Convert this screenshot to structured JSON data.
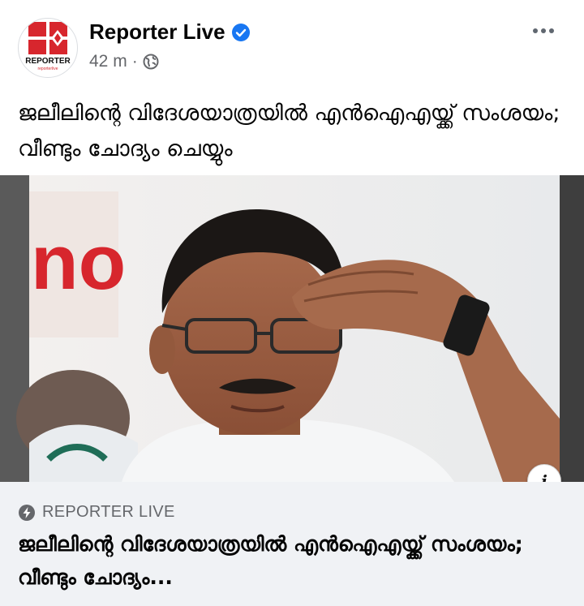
{
  "post": {
    "page_name": "Reporter Live",
    "time": "42 m",
    "separator": "·",
    "more_icon": "more-horizontal-icon",
    "caption": "ജലീലിന്റെ വിദേശയാത്രയിൽ എൻഐഎയ്ക്ക് സംശയം; വീണ്ടും ചോദ്യം ചെയ്യും"
  },
  "avatar": {
    "logo_text": "REPORTER",
    "logo_sub": "reporterlive"
  },
  "link_preview": {
    "source": "REPORTER LIVE",
    "title": "ജലീലിന്റെ വിദേശയാത്രയിൽ എൻഐഎയ്ക്ക് സംശയം; വീണ്ടും ചോദ്യം...",
    "info_label": "i"
  },
  "colors": {
    "brand_red": "#d7262d",
    "verified_blue": "#1877f2",
    "meta_gray": "#65676b",
    "card_bg": "#f0f2f5"
  }
}
